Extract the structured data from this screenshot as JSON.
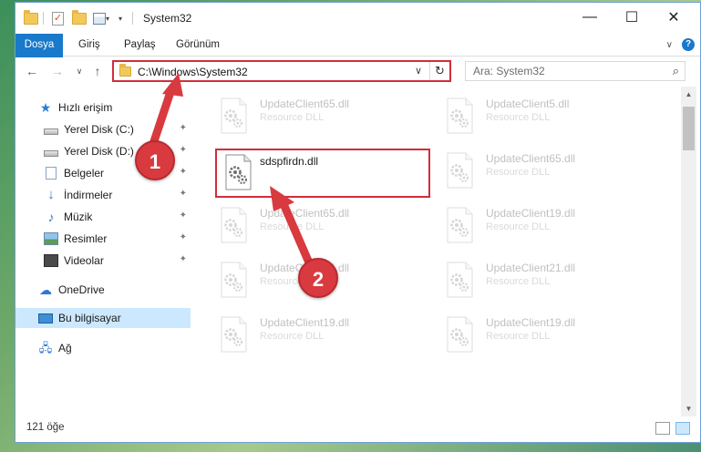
{
  "window": {
    "title": "System32",
    "controls": {
      "minimize": "—",
      "maximize": "☐",
      "close": "✕"
    }
  },
  "ribbon": {
    "tabs": [
      "Dosya",
      "Giriş",
      "Paylaş",
      "Görünüm"
    ]
  },
  "nav": {
    "back": "←",
    "forward": "→",
    "recent": "∨",
    "up": "↑",
    "address": "C:\\Windows\\System32",
    "address_dropdown": "∨",
    "refresh": "↻",
    "search_placeholder": "Ara: System32",
    "search_icon": "⌕"
  },
  "sidebar": {
    "items": [
      {
        "label": "Hızlı erişim",
        "icon": "star-icon",
        "pinned": false
      },
      {
        "label": "Yerel Disk (C:)",
        "icon": "drive-icon",
        "pinned": true
      },
      {
        "label": "Yerel Disk (D:)",
        "icon": "drive-icon",
        "pinned": true
      },
      {
        "label": "Belgeler",
        "icon": "documents-icon",
        "pinned": true
      },
      {
        "label": "İndirmeler",
        "icon": "downloads-icon",
        "pinned": true
      },
      {
        "label": "Müzik",
        "icon": "music-icon",
        "pinned": true
      },
      {
        "label": "Resimler",
        "icon": "pictures-icon",
        "pinned": true
      },
      {
        "label": "Videolar",
        "icon": "videos-icon",
        "pinned": true
      },
      {
        "label": "OneDrive",
        "icon": "onedrive-icon",
        "pinned": false
      },
      {
        "label": "Bu bilgisayar",
        "icon": "this-pc-icon",
        "pinned": false,
        "selected": true
      },
      {
        "label": "Ağ",
        "icon": "network-icon",
        "pinned": false
      }
    ],
    "pin_glyph": "📌"
  },
  "files": {
    "left": [
      {
        "name": "UpdateClient65.dll",
        "desc": "Resource DLL"
      },
      {
        "name": "sdspfirdn.dll",
        "desc": ""
      },
      {
        "name": "UpdateClient65.dll",
        "desc": "Resource DLL"
      },
      {
        "name": "UpdateClient65.dll",
        "desc": "Resource DLL"
      },
      {
        "name": "UpdateClient19.dll",
        "desc": "Resource DLL"
      }
    ],
    "right": [
      {
        "name": "UpdateClient5.dll",
        "desc": "Resource DLL"
      },
      {
        "name": "UpdateClient65.dll",
        "desc": "Resource DLL"
      },
      {
        "name": "UpdateClient19.dll",
        "desc": "Resource DLL"
      },
      {
        "name": "UpdateClient21.dll",
        "desc": "Resource DLL"
      },
      {
        "name": "UpdateClient19.dll",
        "desc": "Resource DLL"
      }
    ]
  },
  "status": {
    "item_count": "121 öğe"
  },
  "annotations": {
    "callout_1": "1",
    "callout_2": "2",
    "color": "#d93a3f"
  },
  "colors": {
    "accent": "#1979ca",
    "highlight_border": "#d22d3b",
    "selected_bg": "#cce8ff"
  }
}
